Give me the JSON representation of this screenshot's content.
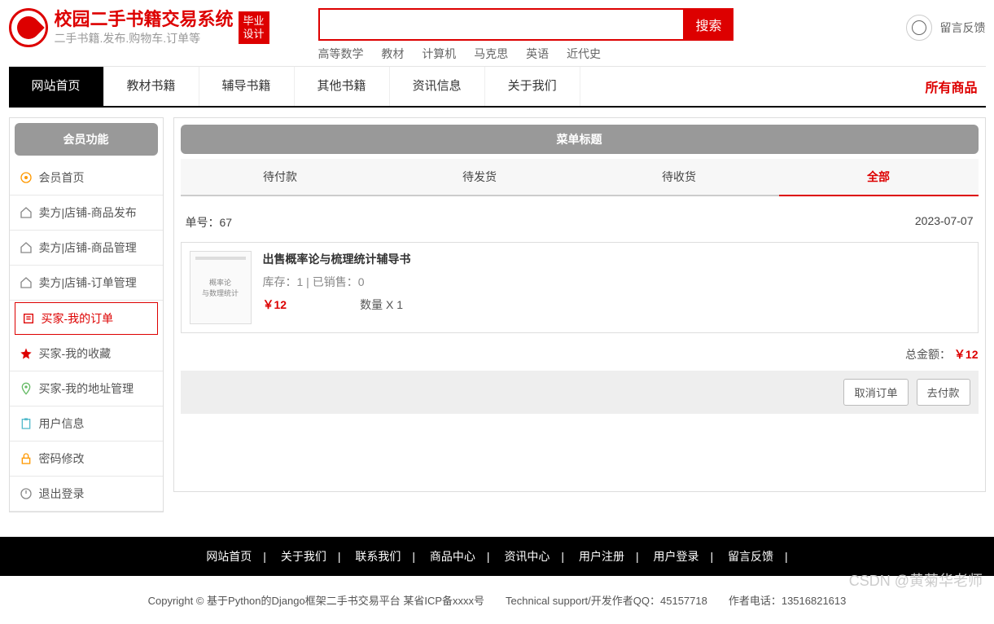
{
  "header": {
    "title": "校园二手书籍交易系统",
    "subtitle": "二手书籍.发布.购物车.订单等",
    "badge_l1": "毕业",
    "badge_l2": "设计",
    "search_btn": "搜索",
    "tags": [
      "高等数学",
      "教材",
      "计算机",
      "马克思",
      "英语",
      "近代史"
    ],
    "feedback": "留言反馈"
  },
  "nav": {
    "items": [
      "网站首页",
      "教材书籍",
      "辅导书籍",
      "其他书籍",
      "资讯信息",
      "关于我们"
    ],
    "right": "所有商品"
  },
  "sidebar": {
    "title": "会员功能",
    "items": [
      "会员首页",
      "卖方|店铺-商品发布",
      "卖方|店铺-商品管理",
      "卖方|店铺-订单管理",
      "买家-我的订单",
      "买家-我的收藏",
      "买家-我的地址管理",
      "用户信息",
      "密码修改",
      "退出登录"
    ]
  },
  "panel": {
    "title": "菜单标题",
    "tabs": [
      "待付款",
      "待发货",
      "待收货",
      "全部"
    ]
  },
  "order": {
    "no_label": "单号：",
    "no": "67",
    "date": "2023-07-07",
    "book_title": "出售概率论与梳理统计辅导书",
    "stock": "库存：1 | 已销售：0",
    "price": "￥12",
    "qty": "数量 X 1",
    "cover_l1": "概率论",
    "cover_l2": "与数理统计",
    "total_label": "总金额：",
    "total": "￥12",
    "cancel": "取消订单",
    "pay": "去付款"
  },
  "footer": {
    "links": [
      "网站首页",
      "关于我们",
      "联系我们",
      "商品中心",
      "资讯中心",
      "用户注册",
      "用户登录",
      "留言反馈"
    ],
    "copyright": "Copyright © 基于Python的Django框架二手书交易平台 某省ICP备xxxx号　　Technical support/开发作者QQ：45157718　　作者电话：13516821613"
  },
  "watermark": "CSDN @黄菊华老师"
}
